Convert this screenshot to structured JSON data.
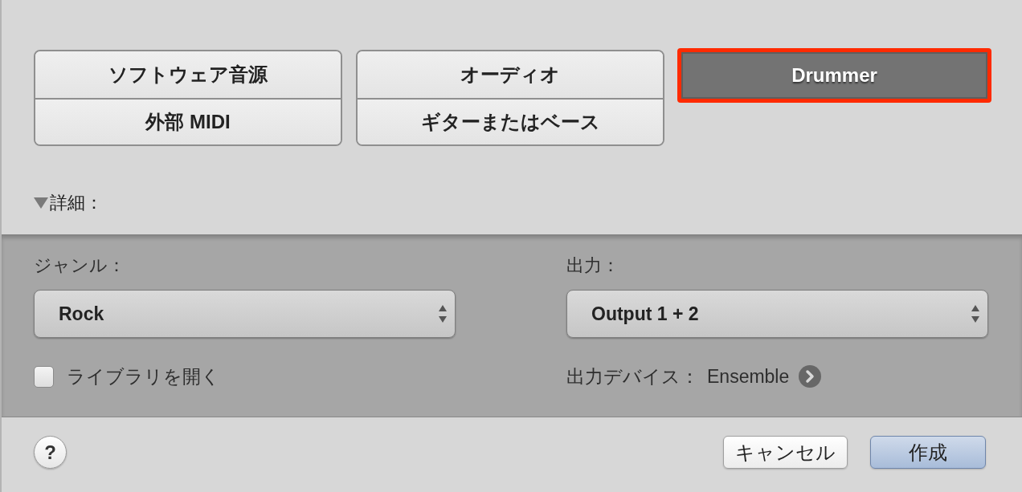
{
  "track_type_groups": [
    {
      "items": [
        {
          "label": "ソフトウェア音源",
          "selected": false
        },
        {
          "label": "外部 MIDI",
          "selected": false
        }
      ]
    },
    {
      "items": [
        {
          "label": "オーディオ",
          "selected": false
        },
        {
          "label": "ギターまたはベース",
          "selected": false
        }
      ]
    },
    {
      "items": [
        {
          "label": "Drummer",
          "selected": true
        }
      ]
    }
  ],
  "details": {
    "label": "詳細：",
    "expanded": true
  },
  "genre": {
    "label": "ジャンル：",
    "value": "Rock"
  },
  "library_checkbox": {
    "label": "ライブラリを開く",
    "checked": false
  },
  "output": {
    "label": "出力：",
    "value": "Output 1 + 2"
  },
  "output_device": {
    "label": "出力デバイス：",
    "value": "Ensemble"
  },
  "footer": {
    "help": "?",
    "buttons": [
      {
        "label": "キャンセル",
        "kind": "secondary"
      },
      {
        "label": "作成",
        "kind": "primary"
      }
    ]
  }
}
